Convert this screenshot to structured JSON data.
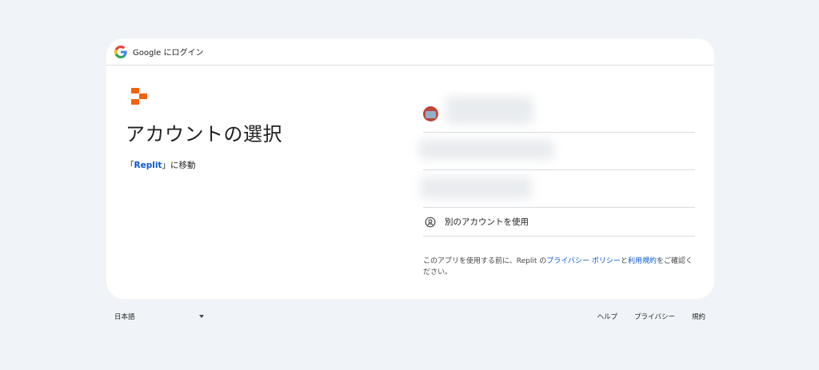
{
  "header": {
    "text": "Google にログイン"
  },
  "main": {
    "title": "アカウントの選択",
    "goto_prefix": "「",
    "goto_app": "Replit",
    "goto_suffix": "」に移動"
  },
  "accounts": {
    "other_account_label": "別のアカウントを使用"
  },
  "notice": {
    "text_before": "このアプリを使用する前に、Replit の",
    "privacy_link": "プライバシー ポリシー",
    "and": "と",
    "terms_link": "利用規約",
    "text_after": "をご確認ください。"
  },
  "footer": {
    "language": "日本語",
    "links": [
      "ヘルプ",
      "プライバシー",
      "規約"
    ]
  },
  "colors": {
    "background": "#f0f4f9",
    "link": "#0b57d0",
    "replit_orange": "#f26207"
  }
}
